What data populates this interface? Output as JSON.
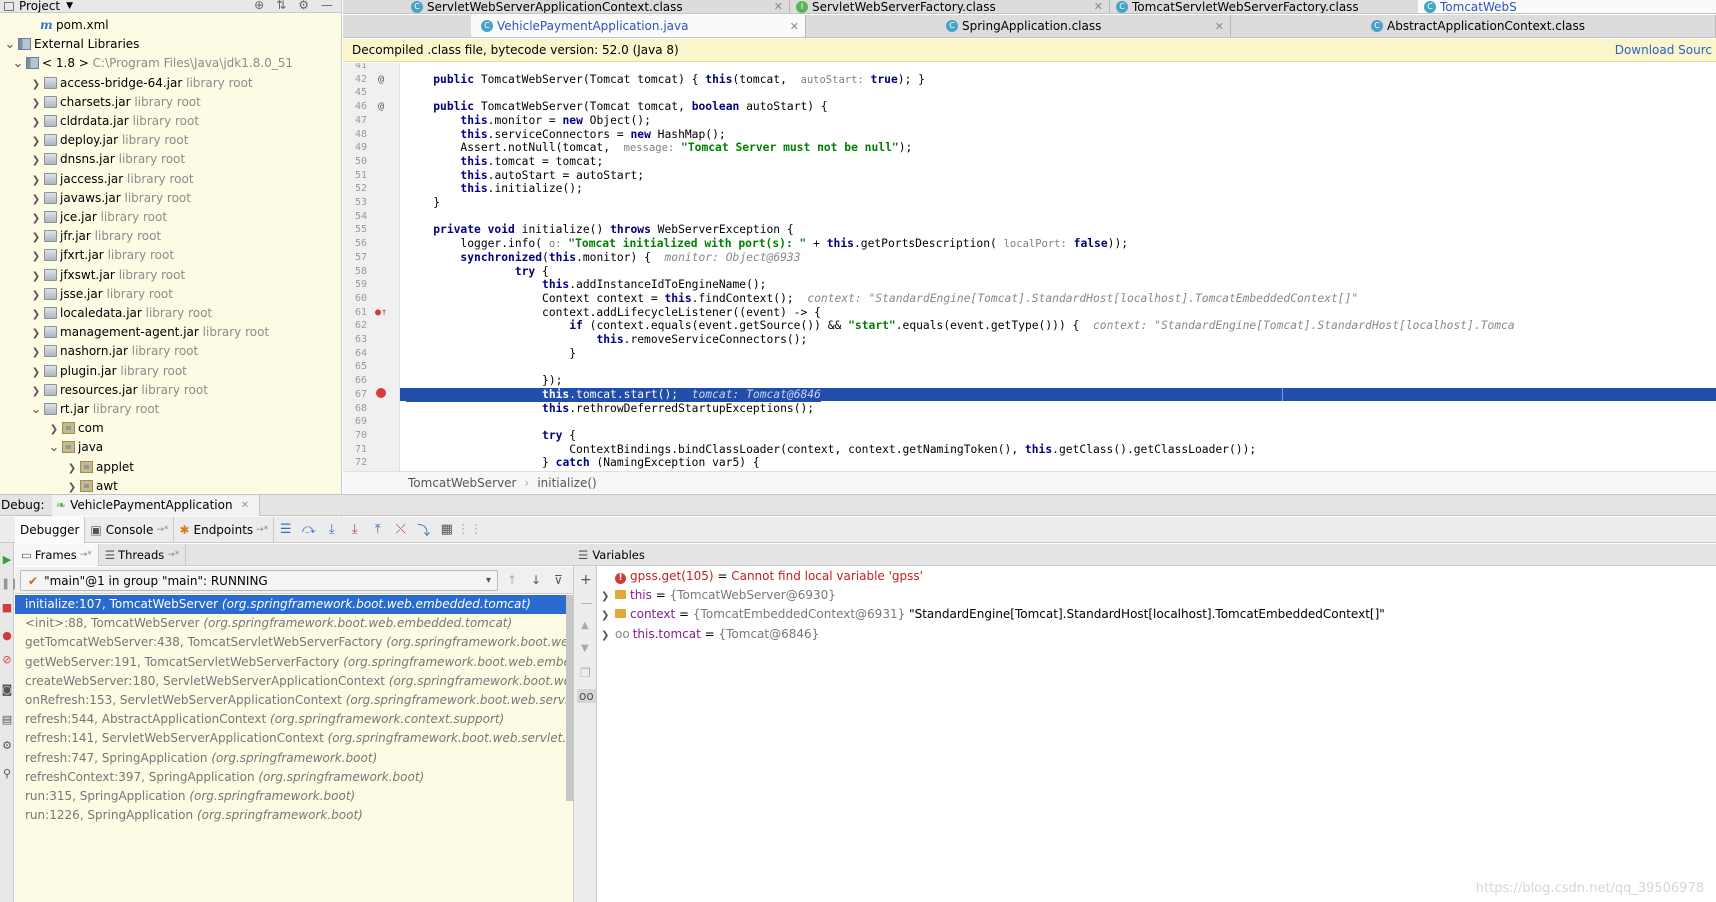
{
  "project": {
    "title": "Project",
    "items": [
      {
        "label": "pom.xml",
        "hint": "",
        "icon": "maven-file-icon",
        "indent": 28,
        "arrow": ""
      },
      {
        "label": "External Libraries",
        "hint": "",
        "icon": "library-icon",
        "indent": 4,
        "arrow": "down"
      },
      {
        "label": "< 1.8 >",
        "hint": "C:\\Program Files\\Java\\jdk1.8.0_51",
        "icon": "jdk-icon",
        "indent": 12,
        "arrow": "down"
      },
      {
        "label": "access-bridge-64.jar",
        "hint": "library root",
        "icon": "jar-icon",
        "indent": 30,
        "arrow": "right"
      },
      {
        "label": "charsets.jar",
        "hint": "library root",
        "icon": "jar-icon",
        "indent": 30,
        "arrow": "right"
      },
      {
        "label": "cldrdata.jar",
        "hint": "library root",
        "icon": "jar-icon",
        "indent": 30,
        "arrow": "right"
      },
      {
        "label": "deploy.jar",
        "hint": "library root",
        "icon": "jar-icon",
        "indent": 30,
        "arrow": "right"
      },
      {
        "label": "dnsns.jar",
        "hint": "library root",
        "icon": "jar-icon",
        "indent": 30,
        "arrow": "right"
      },
      {
        "label": "jaccess.jar",
        "hint": "library root",
        "icon": "jar-icon",
        "indent": 30,
        "arrow": "right"
      },
      {
        "label": "javaws.jar",
        "hint": "library root",
        "icon": "jar-icon",
        "indent": 30,
        "arrow": "right"
      },
      {
        "label": "jce.jar",
        "hint": "library root",
        "icon": "jar-icon",
        "indent": 30,
        "arrow": "right"
      },
      {
        "label": "jfr.jar",
        "hint": "library root",
        "icon": "jar-icon",
        "indent": 30,
        "arrow": "right"
      },
      {
        "label": "jfxrt.jar",
        "hint": "library root",
        "icon": "jar-icon",
        "indent": 30,
        "arrow": "right"
      },
      {
        "label": "jfxswt.jar",
        "hint": "library root",
        "icon": "jar-icon",
        "indent": 30,
        "arrow": "right"
      },
      {
        "label": "jsse.jar",
        "hint": "library root",
        "icon": "jar-icon",
        "indent": 30,
        "arrow": "right"
      },
      {
        "label": "localedata.jar",
        "hint": "library root",
        "icon": "jar-icon",
        "indent": 30,
        "arrow": "right"
      },
      {
        "label": "management-agent.jar",
        "hint": "library root",
        "icon": "jar-icon",
        "indent": 30,
        "arrow": "right"
      },
      {
        "label": "nashorn.jar",
        "hint": "library root",
        "icon": "jar-icon",
        "indent": 30,
        "arrow": "right"
      },
      {
        "label": "plugin.jar",
        "hint": "library root",
        "icon": "jar-icon",
        "indent": 30,
        "arrow": "right"
      },
      {
        "label": "resources.jar",
        "hint": "library root",
        "icon": "jar-icon",
        "indent": 30,
        "arrow": "right"
      },
      {
        "label": "rt.jar",
        "hint": "library root",
        "icon": "jar-icon",
        "indent": 30,
        "arrow": "down"
      },
      {
        "label": "com",
        "hint": "",
        "icon": "package-icon",
        "indent": 48,
        "arrow": "right"
      },
      {
        "label": "java",
        "hint": "",
        "icon": "package-icon",
        "indent": 48,
        "arrow": "down"
      },
      {
        "label": "applet",
        "hint": "",
        "icon": "package-icon",
        "indent": 66,
        "arrow": "right"
      },
      {
        "label": "awt",
        "hint": "",
        "icon": "package-icon",
        "indent": 66,
        "arrow": "right"
      }
    ]
  },
  "tabs_row1": [
    {
      "label": "ServletWebServerApplicationContext.class",
      "icon": "class-icon"
    },
    {
      "label": "ServletWebServerFactory.class",
      "icon": "interface-icon"
    },
    {
      "label": "TomcatServletWebServerFactory.class",
      "icon": "class-icon"
    },
    {
      "label": "TomcatWebS",
      "icon": "class-icon"
    }
  ],
  "tabs_row2": [
    {
      "label": "VehiclePaymentApplication.java",
      "icon": "class-icon"
    },
    {
      "label": "SpringApplication.class",
      "icon": "class-icon"
    },
    {
      "label": "AbstractApplicationContext.class",
      "icon": "class-icon"
    }
  ],
  "editor": {
    "banner": "Decompiled .class file, bytecode version: 52.0 (Java 8)",
    "download_source": "Download Sourc",
    "breadcrumb": [
      "TomcatWebServer",
      "initialize()"
    ],
    "lines": [
      {
        "n": "41",
        "mark": "",
        "html": ""
      },
      {
        "n": "42",
        "mark": "@",
        "html": "    <span class=\"kw\">public</span> TomcatWebServer(Tomcat tomcat) { <span class=\"kw\">this</span>(tomcat,  <span class=\"hint\">autoStart:</span> <span class=\"kw\">true</span>); }"
      },
      {
        "n": "45",
        "mark": "",
        "html": ""
      },
      {
        "n": "46",
        "mark": "@",
        "html": "    <span class=\"kw\">public</span> TomcatWebServer(Tomcat tomcat, <span class=\"kw\">boolean</span> autoStart) {"
      },
      {
        "n": "47",
        "mark": "",
        "html": "        <span class=\"kw\">this</span>.monitor = <span class=\"kw\">new</span> Object();"
      },
      {
        "n": "48",
        "mark": "",
        "html": "        <span class=\"kw\">this</span>.serviceConnectors = <span class=\"kw\">new</span> HashMap();"
      },
      {
        "n": "49",
        "mark": "",
        "html": "        Assert.notNull(tomcat,  <span class=\"hint\">message:</span> <span class=\"str\">\"Tomcat Server must not be null\"</span>);"
      },
      {
        "n": "50",
        "mark": "",
        "html": "        <span class=\"kw\">this</span>.tomcat = tomcat;"
      },
      {
        "n": "51",
        "mark": "",
        "html": "        <span class=\"kw\">this</span>.autoStart = autoStart;"
      },
      {
        "n": "52",
        "mark": "",
        "html": "        <span class=\"kw\">this</span>.initialize();"
      },
      {
        "n": "53",
        "mark": "",
        "html": "    }"
      },
      {
        "n": "54",
        "mark": "",
        "html": ""
      },
      {
        "n": "55",
        "mark": "",
        "html": "    <span class=\"kw\">private void</span> initialize() <span class=\"kw\">throws</span> WebServerException {"
      },
      {
        "n": "56",
        "mark": "",
        "html": "        logger.info( <span class=\"hint\">o:</span> <span class=\"str\">\"Tomcat initialized with port(s): \"</span> + <span class=\"kw\">this</span>.getPortsDescription( <span class=\"hint\">localPort:</span> <span class=\"kw\">false</span>));"
      },
      {
        "n": "57",
        "mark": "",
        "html": "        <span class=\"kw\">synchronized</span>(<span class=\"kw\">this</span>.monitor) {  <span class=\"inlay\">monitor: Object@6933</span>"
      },
      {
        "n": "58",
        "mark": "",
        "html": "                <span class=\"kw\">try</span> {"
      },
      {
        "n": "59",
        "mark": "",
        "html": "                    <span class=\"kw\">this</span>.addInstanceIdToEngineName();"
      },
      {
        "n": "60",
        "mark": "",
        "html": "                    Context context = <span class=\"kw\">this</span>.findContext();  <span class=\"inlay\">context: \"StandardEngine[Tomcat].StandardHost[localhost].TomcatEmbeddedContext[]\"</span>"
      },
      {
        "n": "61",
        "mark": "bp-arrow",
        "html": "                    context.addLifecycleListener((event) -> {"
      },
      {
        "n": "62",
        "mark": "",
        "html": "                        <span class=\"kw\">if</span> (context.equals(event.getSource()) &amp;&amp; <span class=\"str\">\"start\"</span>.equals(event.getType())) {  <span class=\"inlay\">context: \"StandardEngine[Tomcat].StandardHost[localhost].Tomca</span>"
      },
      {
        "n": "63",
        "mark": "",
        "html": "                            <span class=\"kw\">this</span>.removeServiceConnectors();"
      },
      {
        "n": "64",
        "mark": "",
        "html": "                        }"
      },
      {
        "n": "65",
        "mark": "",
        "html": ""
      },
      {
        "n": "66",
        "mark": "",
        "html": "                    });"
      },
      {
        "n": "67",
        "mark": "bp",
        "html": "                    <span class=\"kw\">this</span>.tomcat.start();  <span class=\"inlay\">tomcat: Tomcat@6846</span>",
        "highlight": true
      },
      {
        "n": "68",
        "mark": "",
        "html": "                    <span class=\"kw\">this</span>.rethrowDeferredStartupExceptions();"
      },
      {
        "n": "69",
        "mark": "",
        "html": ""
      },
      {
        "n": "70",
        "mark": "",
        "html": "                    <span class=\"kw\">try</span> {"
      },
      {
        "n": "71",
        "mark": "",
        "html": "                        ContextBindings.bindClassLoader(context, context.getNamingToken(), <span class=\"kw\">this</span>.getClass().getClassLoader());"
      },
      {
        "n": "72",
        "mark": "",
        "html": "                    } <span class=\"kw\">catch</span> (NamingException var5) {"
      }
    ]
  },
  "debug": {
    "label": "Debug:",
    "session": "VehiclePaymentApplication",
    "tabs": {
      "debugger": "Debugger",
      "console": "Console",
      "endpoints": "Endpoints"
    },
    "frames_tab": "Frames",
    "threads_tab": "Threads",
    "thread": "\"main\"@1 in group \"main\": RUNNING",
    "frames": [
      {
        "method": "initialize:107, TomcatWebServer",
        "pkg": "(org.springframework.boot.web.embedded.tomcat)"
      },
      {
        "method": "<init>:88, TomcatWebServer",
        "pkg": "(org.springframework.boot.web.embedded.tomcat)"
      },
      {
        "method": "getTomcatWebServer:438, TomcatServletWebServerFactory",
        "pkg": "(org.springframework.boot.web.embedded"
      },
      {
        "method": "getWebServer:191, TomcatServletWebServerFactory",
        "pkg": "(org.springframework.boot.web.embedded.tomca"
      },
      {
        "method": "createWebServer:180, ServletWebServerApplicationContext",
        "pkg": "(org.springframework.boot.web.servlet.con"
      },
      {
        "method": "onRefresh:153, ServletWebServerApplicationContext",
        "pkg": "(org.springframework.boot.web.servlet.context)"
      },
      {
        "method": "refresh:544, AbstractApplicationContext",
        "pkg": "(org.springframework.context.support)"
      },
      {
        "method": "refresh:141, ServletWebServerApplicationContext",
        "pkg": "(org.springframework.boot.web.servlet.context)"
      },
      {
        "method": "refresh:747, SpringApplication",
        "pkg": "(org.springframework.boot)"
      },
      {
        "method": "refreshContext:397, SpringApplication",
        "pkg": "(org.springframework.boot)"
      },
      {
        "method": "run:315, SpringApplication",
        "pkg": "(org.springframework.boot)"
      },
      {
        "method": "run:1226, SpringApplication",
        "pkg": "(org.springframework.boot)"
      }
    ],
    "variables_title": "Variables",
    "variables": [
      {
        "kind": "error",
        "name": "gpss.get(105)",
        "eq": " = ",
        "type": "",
        "value": "Cannot find local variable 'gpss'"
      },
      {
        "kind": "field",
        "name": "this",
        "eq": " = ",
        "type": "{TomcatWebServer@6930}",
        "value": ""
      },
      {
        "kind": "field",
        "name": "context",
        "eq": " = ",
        "type": "{TomcatEmbeddedContext@6931}",
        "value": "\"StandardEngine[Tomcat].StandardHost[localhost].TomcatEmbeddedContext[]\""
      },
      {
        "kind": "watch",
        "name": "this.tomcat",
        "eq": " = ",
        "type": "{Tomcat@6846}",
        "value": ""
      }
    ]
  },
  "watermark": "https://blog.csdn.net/qq_39506978"
}
